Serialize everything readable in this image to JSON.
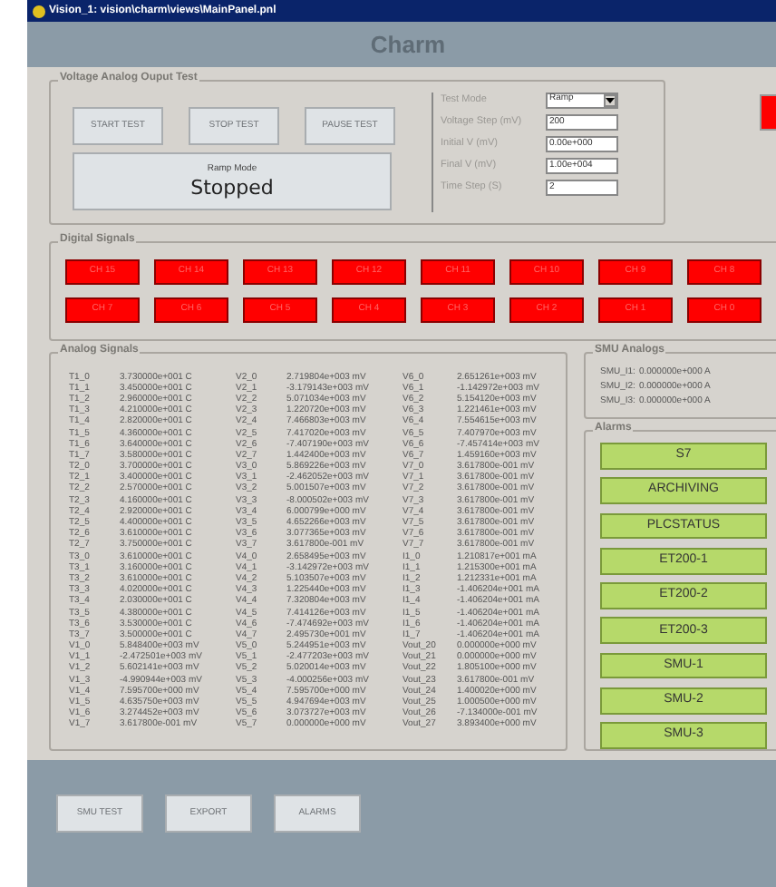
{
  "window": {
    "title": "Vision_1: vision\\charm\\views\\MainPanel.pnl"
  },
  "header": {
    "title": "Charm"
  },
  "voltage_test": {
    "title": "Voltage Analog Ouput Test",
    "buttons": [
      "START TEST",
      "STOP TEST",
      "PAUSE TEST"
    ],
    "mode_label": "Ramp Mode",
    "status": "Stopped",
    "fields": [
      {
        "kind": "select",
        "label": "Test Mode",
        "value": "Ramp"
      },
      {
        "kind": "input",
        "label": "Voltage Step (mV)",
        "value": "200"
      },
      {
        "kind": "input",
        "label": "Initial V (mV)",
        "value": "0.00e+000"
      },
      {
        "kind": "input",
        "label": "Final V (mV)",
        "value": "1.00e+004"
      },
      {
        "kind": "input",
        "label": "Time Step (S)",
        "value": "2"
      }
    ],
    "indicator": {
      "on": true
    }
  },
  "digital_signals": {
    "title": "Digital Signals",
    "channels": [
      {
        "label": "CH 15",
        "on": true
      },
      {
        "label": "CH 14",
        "on": true
      },
      {
        "label": "CH 13",
        "on": true
      },
      {
        "label": "CH 12",
        "on": true
      },
      {
        "label": "CH 11",
        "on": true
      },
      {
        "label": "CH 10",
        "on": true
      },
      {
        "label": "CH 9",
        "on": true
      },
      {
        "label": "CH 8",
        "on": true
      },
      {
        "label": "CH 7",
        "on": true
      },
      {
        "label": "CH 6",
        "on": true
      },
      {
        "label": "CH 5",
        "on": true
      },
      {
        "label": "CH 4",
        "on": true
      },
      {
        "label": "CH 3",
        "on": true
      },
      {
        "label": "CH 2",
        "on": true
      },
      {
        "label": "CH 1",
        "on": true
      },
      {
        "label": "CH 0",
        "on": true
      }
    ]
  },
  "analog_signals": {
    "title": "Analog Signals",
    "columns": [
      [
        [
          "T1_0",
          "3.730000e+001 C"
        ],
        [
          "T1_1",
          "3.450000e+001 C"
        ],
        [
          "T1_2",
          "2.960000e+001 C"
        ],
        [
          "T1_3",
          "4.210000e+001 C"
        ],
        [
          "T1_4",
          "2.820000e+001 C"
        ],
        [
          "T1_5",
          "4.360000e+001 C"
        ],
        [
          "T1_6",
          "3.640000e+001 C"
        ],
        [
          "T1_7",
          "3.580000e+001 C"
        ],
        [
          "T2_0",
          "3.700000e+001 C"
        ],
        [
          "T2_1",
          "3.400000e+001 C"
        ],
        [
          "T2_2",
          "2.570000e+001 C"
        ],
        [
          "T2_3",
          "4.160000e+001 C"
        ],
        [
          "T2_4",
          "2.920000e+001 C"
        ],
        [
          "T2_5",
          "4.400000e+001 C"
        ],
        [
          "T2_6",
          "3.610000e+001 C"
        ],
        [
          "T2_7",
          "3.750000e+001 C"
        ],
        [
          "T3_0",
          "3.610000e+001 C"
        ],
        [
          "T3_1",
          "3.160000e+001 C"
        ],
        [
          "T3_2",
          "3.610000e+001 C"
        ],
        [
          "T3_3",
          "4.020000e+001 C"
        ],
        [
          "T3_4",
          "2.030000e+001 C"
        ],
        [
          "T3_5",
          "4.380000e+001 C"
        ],
        [
          "T3_6",
          "3.530000e+001 C"
        ],
        [
          "T3_7",
          "3.500000e+001 C"
        ],
        [
          "V1_0",
          "5.848400e+003 mV"
        ],
        [
          "V1_1",
          "-2.472501e+003 mV"
        ],
        [
          "V1_2",
          "5.602141e+003 mV"
        ],
        [
          "V1_3",
          "-4.990944e+003 mV"
        ],
        [
          "V1_4",
          "7.595700e+000 mV"
        ],
        [
          "V1_5",
          "4.635750e+003 mV"
        ],
        [
          "V1_6",
          "3.274452e+003 mV"
        ],
        [
          "V1_7",
          "3.617800e-001 mV"
        ]
      ],
      [
        [
          "V2_0",
          "2.719804e+003 mV"
        ],
        [
          "V2_1",
          "-3.179143e+003 mV"
        ],
        [
          "V2_2",
          "5.071034e+003 mV"
        ],
        [
          "V2_3",
          "1.220720e+003 mV"
        ],
        [
          "V2_4",
          "7.466803e+003 mV"
        ],
        [
          "V2_5",
          "7.417020e+003 mV"
        ],
        [
          "V2_6",
          "-7.407190e+003 mV"
        ],
        [
          "V2_7",
          "1.442400e+003 mV"
        ],
        [
          "V3_0",
          "5.869226e+003 mV"
        ],
        [
          "V3_1",
          "-2.462052e+003 mV"
        ],
        [
          "V3_2",
          "5.001507e+003 mV"
        ],
        [
          "V3_3",
          "-8.000502e+003 mV"
        ],
        [
          "V3_4",
          "6.000799e+000 mV"
        ],
        [
          "V3_5",
          "4.652266e+003 mV"
        ],
        [
          "V3_6",
          "3.077365e+003 mV"
        ],
        [
          "V3_7",
          "3.617800e-001 mV"
        ],
        [
          "V4_0",
          "2.658495e+003 mV"
        ],
        [
          "V4_1",
          "-3.142972e+003 mV"
        ],
        [
          "V4_2",
          "5.103507e+003 mV"
        ],
        [
          "V4_3",
          "1.225440e+003 mV"
        ],
        [
          "V4_4",
          "7.320804e+003 mV"
        ],
        [
          "V4_5",
          "7.414126e+003 mV"
        ],
        [
          "V4_6",
          "-7.474692e+003 mV"
        ],
        [
          "V4_7",
          "2.495730e+001 mV"
        ],
        [
          "V5_0",
          "5.244951e+003 mV"
        ],
        [
          "V5_1",
          "-2.477203e+003 mV"
        ],
        [
          "V5_2",
          "5.020014e+003 mV"
        ],
        [
          "V5_3",
          "-4.000256e+003 mV"
        ],
        [
          "V5_4",
          "7.595700e+000 mV"
        ],
        [
          "V5_5",
          "4.947694e+003 mV"
        ],
        [
          "V5_6",
          "3.073727e+003 mV"
        ],
        [
          "V5_7",
          "0.000000e+000 mV"
        ]
      ],
      [
        [
          "V6_0",
          "2.651261e+003 mV"
        ],
        [
          "V6_1",
          "-1.142972e+003 mV"
        ],
        [
          "V6_2",
          "5.154120e+003 mV"
        ],
        [
          "V6_3",
          "1.221461e+003 mV"
        ],
        [
          "V6_4",
          "7.554615e+003 mV"
        ],
        [
          "V6_5",
          "7.407970e+003 mV"
        ],
        [
          "V6_6",
          "-7.457414e+003 mV"
        ],
        [
          "V6_7",
          "1.459160e+003 mV"
        ],
        [
          "V7_0",
          "3.617800e-001 mV"
        ],
        [
          "V7_1",
          "3.617800e-001 mV"
        ],
        [
          "V7_2",
          "3.617800e-001 mV"
        ],
        [
          "V7_3",
          "3.617800e-001 mV"
        ],
        [
          "V7_4",
          "3.617800e-001 mV"
        ],
        [
          "V7_5",
          "3.617800e-001 mV"
        ],
        [
          "V7_6",
          "3.617800e-001 mV"
        ],
        [
          "V7_7",
          "3.617800e-001 mV"
        ],
        [
          "I1_0",
          "1.210817e+001 mA"
        ],
        [
          "I1_1",
          "1.215300e+001 mA"
        ],
        [
          "I1_2",
          "1.212331e+001 mA"
        ],
        [
          "I1_3",
          "-1.406204e+001 mA"
        ],
        [
          "I1_4",
          "-1.406204e+001 mA"
        ],
        [
          "I1_5",
          "-1.406204e+001 mA"
        ],
        [
          "I1_6",
          "-1.406204e+001 mA"
        ],
        [
          "I1_7",
          "-1.406204e+001 mA"
        ],
        [
          "Vout_20",
          "0.000000e+000 mV"
        ],
        [
          "Vout_21",
          "0.000000e+000 mV"
        ],
        [
          "Vout_22",
          "1.805100e+000 mV"
        ],
        [
          "Vout_23",
          "3.617800e-001 mV"
        ],
        [
          "Vout_24",
          "1.400020e+000 mV"
        ],
        [
          "Vout_25",
          "1.000500e+000 mV"
        ],
        [
          "Vout_26",
          "-7.134000e-001 mV"
        ],
        [
          "Vout_27",
          "3.893400e+000 mV"
        ]
      ]
    ]
  },
  "smu_analogs": {
    "title": "SMU Analogs",
    "rows": [
      [
        "SMU_I1:",
        "0.000000e+000 A"
      ],
      [
        "SMU_I2:",
        "0.000000e+000 A"
      ],
      [
        "SMU_I3:",
        "0.000000e+000 A"
      ]
    ]
  },
  "alarms": {
    "title": "Alarms",
    "items": [
      "S7",
      "ARCHIVING",
      "PLCSTATUS",
      "ET200-1",
      "ET200-2",
      "ET200-3",
      "SMU-1",
      "SMU-2",
      "SMU-3"
    ]
  },
  "footer_buttons": [
    "SMU TEST",
    "EXPORT",
    "ALARMS"
  ]
}
